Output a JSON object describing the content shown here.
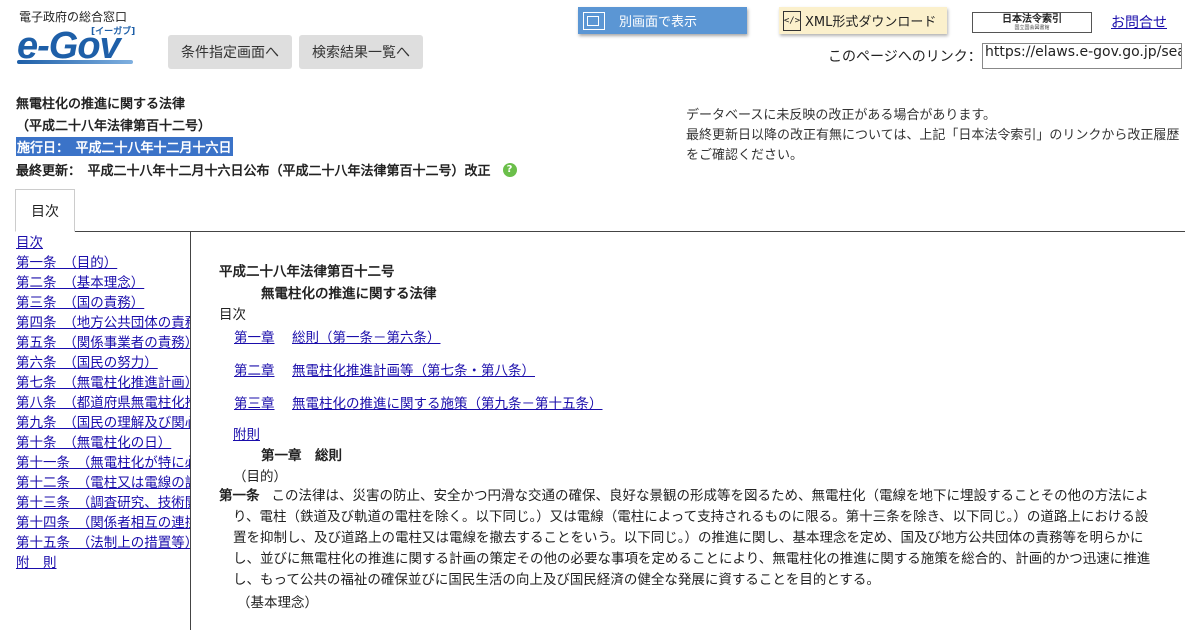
{
  "header": {
    "logo_subtitle": "電子政府の総合窓口",
    "logo_main": "e-Gov",
    "logo_tag": "[イーガブ]",
    "cond_button": "条件指定画面へ",
    "result_button": "検索結果一覧へ",
    "window_button": "別画面で表示",
    "xml_button": "XML形式ダウンロード",
    "index_button_title": "日本法令索引",
    "index_button_sub": "国立国会図書館",
    "contact_link": "お問合せ",
    "link_label": "このページへのリンク：",
    "link_value": "https://elaws.e-gov.go.jp/search"
  },
  "law": {
    "title": "無電柱化の推進に関する法律",
    "number": "（平成二十八年法律第百十二号）",
    "enforcement": "施行日：　平成二十八年十二月十六日",
    "last_updated": "最終更新：　平成二十八年十二月十六日公布（平成二十八年法律第百十二号）改正",
    "help_icon": "?"
  },
  "notice": {
    "line1": "データベースに未反映の改正がある場合があります。",
    "line2": "最終更新日以降の改正有無については、上記「日本法令索引」のリンクから改正履歴をご確認ください。"
  },
  "tab": {
    "label": "目次"
  },
  "sidebar": {
    "items": [
      "目次",
      "第一条　（目的）",
      "第二条　（基本理念）",
      "第三条　（国の責務）",
      "第四条　（地方公共団体の責務）",
      "第五条　（関係事業者の責務）",
      "第六条　（国民の努力）",
      "第七条　（無電柱化推進計画）",
      "第八条　（都道府県無電柱化推進計画等）",
      "第九条　（国民の理解及び関心の増進）",
      "第十条　（無電柱化の日）",
      "第十一条　（無電柱化が特に必要であると認められる道路の占用の禁止等）",
      "第十二条　（電柱又は電線の設置の抑制及び撤去）",
      "第十三条　（調査研究、技術開発等の推進等）",
      "第十四条　（関係者相互の連携及び協力）",
      "第十五条　（法制上の措置等）",
      "附　則"
    ]
  },
  "main": {
    "law_number": "平成二十八年法律第百十二号",
    "law_title": "無電柱化の推進に関する法律",
    "toc_label": "目次",
    "chapters": [
      {
        "num": "第一章",
        "title": "総則（第一条－第六条）"
      },
      {
        "num": "第二章",
        "title": "無電柱化推進計画等（第七条・第八条）"
      },
      {
        "num": "第三章",
        "title": "無電柱化の推進に関する施策（第九条－第十五条）"
      }
    ],
    "supplementary": "附則",
    "chapter1_heading": "第一章　総則",
    "article1_caption": "（目的）",
    "article1_num": "第一条",
    "article1_text": "この法律は、災害の防止、安全かつ円滑な交通の確保、良好な景観の形成等を図るため、無電柱化（電線を地下に埋設することその他の方法により、電柱（鉄道及び軌道の電柱を除く。以下同じ。）又は電線（電柱によって支持されるものに限る。第十三条を除き、以下同じ。）の道路上における設置を抑制し、及び道路上の電柱又は電線を撤去することをいう。以下同じ。）の推進に関し、基本理念を定め、国及び地方公共団体の責務等を明らかにし、並びに無電柱化の推進に関する計画の策定その他の必要な事項を定めることにより、無電柱化の推進に関する施策を総合的、計画的かつ迅速に推進し、もって公共の福祉の確保並びに国民生活の向上及び国民経済の健全な発展に資することを目的とする。",
    "article2_caption": "（基本理念）"
  }
}
